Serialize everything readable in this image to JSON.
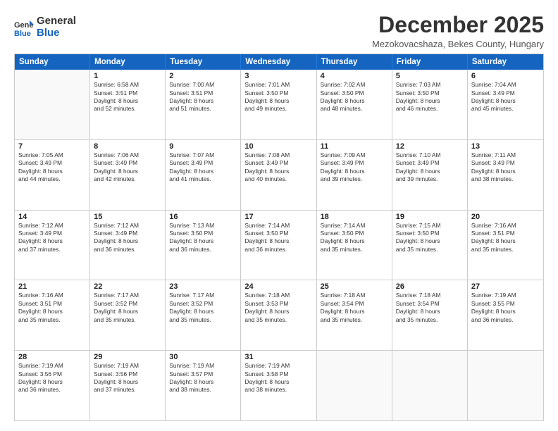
{
  "header": {
    "logo_general": "General",
    "logo_blue": "Blue",
    "month_title": "December 2025",
    "subtitle": "Mezokovacshaza, Bekes County, Hungary"
  },
  "weekdays": [
    "Sunday",
    "Monday",
    "Tuesday",
    "Wednesday",
    "Thursday",
    "Friday",
    "Saturday"
  ],
  "rows": [
    [
      {
        "day": "",
        "lines": [],
        "empty": true
      },
      {
        "day": "1",
        "lines": [
          "Sunrise: 6:58 AM",
          "Sunset: 3:51 PM",
          "Daylight: 8 hours",
          "and 52 minutes."
        ]
      },
      {
        "day": "2",
        "lines": [
          "Sunrise: 7:00 AM",
          "Sunset: 3:51 PM",
          "Daylight: 8 hours",
          "and 51 minutes."
        ]
      },
      {
        "day": "3",
        "lines": [
          "Sunrise: 7:01 AM",
          "Sunset: 3:50 PM",
          "Daylight: 8 hours",
          "and 49 minutes."
        ]
      },
      {
        "day": "4",
        "lines": [
          "Sunrise: 7:02 AM",
          "Sunset: 3:50 PM",
          "Daylight: 8 hours",
          "and 48 minutes."
        ]
      },
      {
        "day": "5",
        "lines": [
          "Sunrise: 7:03 AM",
          "Sunset: 3:50 PM",
          "Daylight: 8 hours",
          "and 46 minutes."
        ]
      },
      {
        "day": "6",
        "lines": [
          "Sunrise: 7:04 AM",
          "Sunset: 3:49 PM",
          "Daylight: 8 hours",
          "and 45 minutes."
        ]
      }
    ],
    [
      {
        "day": "7",
        "lines": [
          "Sunrise: 7:05 AM",
          "Sunset: 3:49 PM",
          "Daylight: 8 hours",
          "and 44 minutes."
        ]
      },
      {
        "day": "8",
        "lines": [
          "Sunrise: 7:06 AM",
          "Sunset: 3:49 PM",
          "Daylight: 8 hours",
          "and 42 minutes."
        ]
      },
      {
        "day": "9",
        "lines": [
          "Sunrise: 7:07 AM",
          "Sunset: 3:49 PM",
          "Daylight: 8 hours",
          "and 41 minutes."
        ]
      },
      {
        "day": "10",
        "lines": [
          "Sunrise: 7:08 AM",
          "Sunset: 3:49 PM",
          "Daylight: 8 hours",
          "and 40 minutes."
        ]
      },
      {
        "day": "11",
        "lines": [
          "Sunrise: 7:09 AM",
          "Sunset: 3:49 PM",
          "Daylight: 8 hours",
          "and 39 minutes."
        ]
      },
      {
        "day": "12",
        "lines": [
          "Sunrise: 7:10 AM",
          "Sunset: 3:49 PM",
          "Daylight: 8 hours",
          "and 39 minutes."
        ]
      },
      {
        "day": "13",
        "lines": [
          "Sunrise: 7:11 AM",
          "Sunset: 3:49 PM",
          "Daylight: 8 hours",
          "and 38 minutes."
        ]
      }
    ],
    [
      {
        "day": "14",
        "lines": [
          "Sunrise: 7:12 AM",
          "Sunset: 3:49 PM",
          "Daylight: 8 hours",
          "and 37 minutes."
        ]
      },
      {
        "day": "15",
        "lines": [
          "Sunrise: 7:12 AM",
          "Sunset: 3:49 PM",
          "Daylight: 8 hours",
          "and 36 minutes."
        ]
      },
      {
        "day": "16",
        "lines": [
          "Sunrise: 7:13 AM",
          "Sunset: 3:50 PM",
          "Daylight: 8 hours",
          "and 36 minutes."
        ]
      },
      {
        "day": "17",
        "lines": [
          "Sunrise: 7:14 AM",
          "Sunset: 3:50 PM",
          "Daylight: 8 hours",
          "and 36 minutes."
        ]
      },
      {
        "day": "18",
        "lines": [
          "Sunrise: 7:14 AM",
          "Sunset: 3:50 PM",
          "Daylight: 8 hours",
          "and 35 minutes."
        ]
      },
      {
        "day": "19",
        "lines": [
          "Sunrise: 7:15 AM",
          "Sunset: 3:50 PM",
          "Daylight: 8 hours",
          "and 35 minutes."
        ]
      },
      {
        "day": "20",
        "lines": [
          "Sunrise: 7:16 AM",
          "Sunset: 3:51 PM",
          "Daylight: 8 hours",
          "and 35 minutes."
        ]
      }
    ],
    [
      {
        "day": "21",
        "lines": [
          "Sunrise: 7:16 AM",
          "Sunset: 3:51 PM",
          "Daylight: 8 hours",
          "and 35 minutes."
        ]
      },
      {
        "day": "22",
        "lines": [
          "Sunrise: 7:17 AM",
          "Sunset: 3:52 PM",
          "Daylight: 8 hours",
          "and 35 minutes."
        ]
      },
      {
        "day": "23",
        "lines": [
          "Sunrise: 7:17 AM",
          "Sunset: 3:52 PM",
          "Daylight: 8 hours",
          "and 35 minutes."
        ]
      },
      {
        "day": "24",
        "lines": [
          "Sunrise: 7:18 AM",
          "Sunset: 3:53 PM",
          "Daylight: 8 hours",
          "and 35 minutes."
        ]
      },
      {
        "day": "25",
        "lines": [
          "Sunrise: 7:18 AM",
          "Sunset: 3:54 PM",
          "Daylight: 8 hours",
          "and 35 minutes."
        ]
      },
      {
        "day": "26",
        "lines": [
          "Sunrise: 7:18 AM",
          "Sunset: 3:54 PM",
          "Daylight: 8 hours",
          "and 35 minutes."
        ]
      },
      {
        "day": "27",
        "lines": [
          "Sunrise: 7:19 AM",
          "Sunset: 3:55 PM",
          "Daylight: 8 hours",
          "and 36 minutes."
        ]
      }
    ],
    [
      {
        "day": "28",
        "lines": [
          "Sunrise: 7:19 AM",
          "Sunset: 3:56 PM",
          "Daylight: 8 hours",
          "and 36 minutes."
        ]
      },
      {
        "day": "29",
        "lines": [
          "Sunrise: 7:19 AM",
          "Sunset: 3:56 PM",
          "Daylight: 8 hours",
          "and 37 minutes."
        ]
      },
      {
        "day": "30",
        "lines": [
          "Sunrise: 7:19 AM",
          "Sunset: 3:57 PM",
          "Daylight: 8 hours",
          "and 38 minutes."
        ]
      },
      {
        "day": "31",
        "lines": [
          "Sunrise: 7:19 AM",
          "Sunset: 3:58 PM",
          "Daylight: 8 hours",
          "and 38 minutes."
        ]
      },
      {
        "day": "",
        "lines": [],
        "empty": true
      },
      {
        "day": "",
        "lines": [],
        "empty": true
      },
      {
        "day": "",
        "lines": [],
        "empty": true
      }
    ]
  ]
}
